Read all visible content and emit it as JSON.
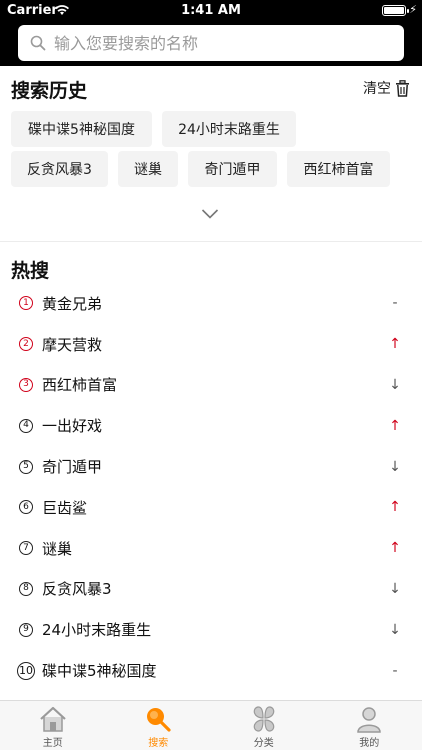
{
  "status_bar": {
    "carrier": "Carrier",
    "time": "1:41 AM"
  },
  "search": {
    "placeholder": "输入您要搜索的名称"
  },
  "history": {
    "title": "搜索历史",
    "clear_label": "清空",
    "items": [
      "碟中谍5神秘国度",
      "24小时末路重生",
      "反贪风暴3",
      "谜巢",
      "奇门遁甲",
      "西红柿首富"
    ]
  },
  "hot": {
    "title": "热搜",
    "items": [
      {
        "rank": "1",
        "name": "黄金兄弟",
        "trend": "-"
      },
      {
        "rank": "2",
        "name": "摩天营救",
        "trend": "↑"
      },
      {
        "rank": "3",
        "name": "西红柿首富",
        "trend": "↓"
      },
      {
        "rank": "4",
        "name": "一出好戏",
        "trend": "↑"
      },
      {
        "rank": "5",
        "name": "奇门遁甲",
        "trend": "↓"
      },
      {
        "rank": "6",
        "name": "巨齿鲨",
        "trend": "↑"
      },
      {
        "rank": "7",
        "name": "谜巢",
        "trend": "↑"
      },
      {
        "rank": "8",
        "name": "反贪风暴3",
        "trend": "↓"
      },
      {
        "rank": "9",
        "name": "24小时末路重生",
        "trend": "↓"
      },
      {
        "rank": "10",
        "name": "碟中谍5神秘国度",
        "trend": "-"
      }
    ]
  },
  "tabs": [
    {
      "label": "主页",
      "icon": "home-icon"
    },
    {
      "label": "搜索",
      "icon": "search-icon"
    },
    {
      "label": "分类",
      "icon": "category-icon"
    },
    {
      "label": "我的",
      "icon": "profile-icon"
    }
  ],
  "colors": {
    "accent": "#ff8a00",
    "trend_up": "#d0021b",
    "top_bar": "#000000"
  }
}
